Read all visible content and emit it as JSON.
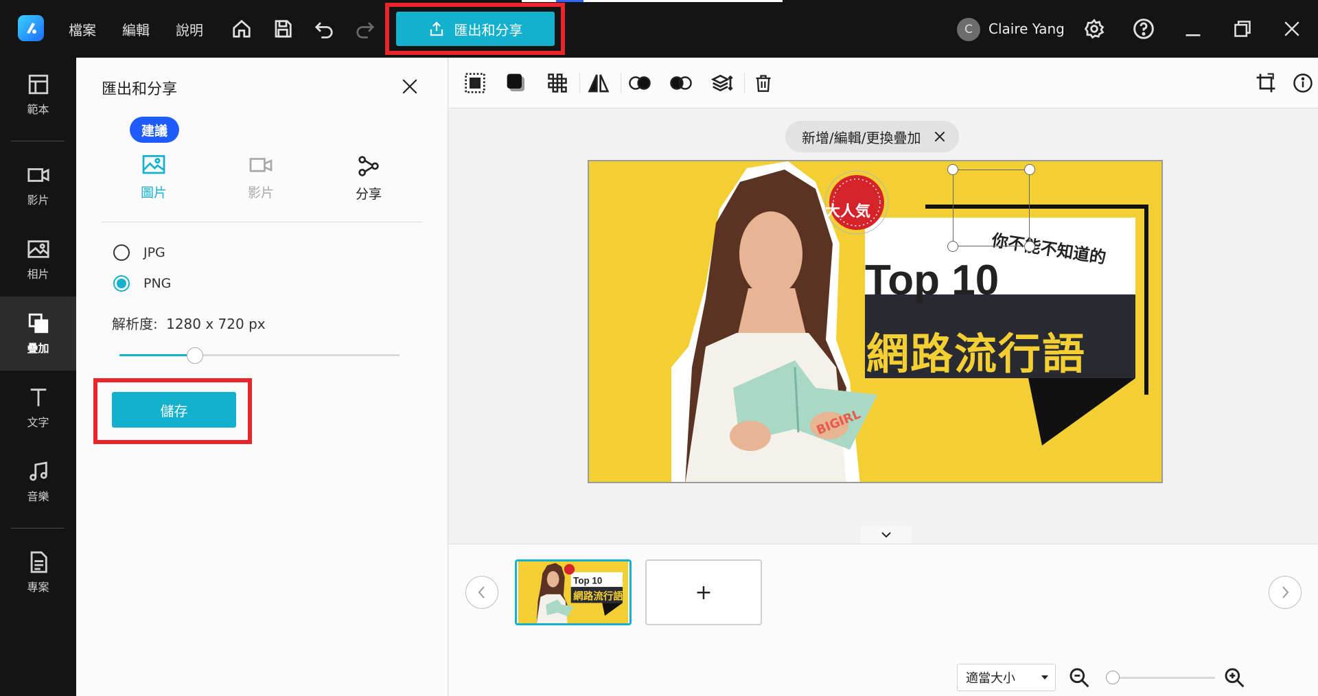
{
  "menu": {
    "file": "檔案",
    "edit": "編輯",
    "help": "說明"
  },
  "export_button": {
    "label": "匯出和分享"
  },
  "user": {
    "initial": "C",
    "name": "Claire Yang"
  },
  "nav": [
    {
      "label": "範本"
    },
    {
      "label": "影片"
    },
    {
      "label": "相片"
    },
    {
      "label": "疊加"
    },
    {
      "label": "文字"
    },
    {
      "label": "音樂"
    },
    {
      "label": "專案"
    }
  ],
  "panel": {
    "title": "匯出和分享",
    "badge": "建議",
    "tabs": [
      {
        "label": "圖片",
        "state": "active"
      },
      {
        "label": "影片",
        "state": "disabled"
      },
      {
        "label": "分享",
        "state": "normal"
      }
    ],
    "formats": [
      {
        "label": "JPG",
        "checked": false
      },
      {
        "label": "PNG",
        "checked": true
      }
    ],
    "resolution_label": "解析度:",
    "resolution_value": "1280 x 720 px",
    "resolution_slider_fraction": 0.27,
    "save_label": "儲存"
  },
  "editor": {
    "overlay_chip": "新增/編輯/更換疊加",
    "canvas_text": {
      "subtitle": "你不能不知道的",
      "top10": "Top 10",
      "headline": "網路流行語",
      "badge": "大人気",
      "book_text": "BIGIRL"
    },
    "add_slide": "+",
    "zoom_select": "適當大小",
    "zoom_fraction": 0.0
  },
  "colors": {
    "accent": "#14b1cf",
    "highlight": "#e8262b",
    "badge_blue": "#1f5cff",
    "poster_yellow": "#f4cf33",
    "dark_bg": "#141414"
  }
}
